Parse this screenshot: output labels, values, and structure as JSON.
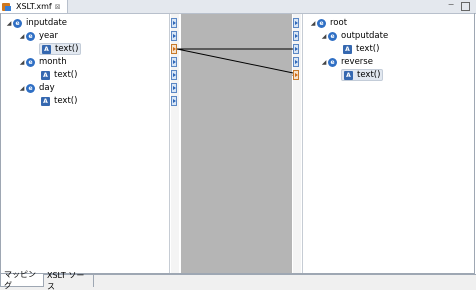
{
  "editor_tab": {
    "title": "XSLT.xmf",
    "close": "⊠"
  },
  "window_controls": {
    "minimize": "−"
  },
  "source_tree": {
    "root": "inputdate",
    "nodes": [
      {
        "name": "year",
        "child": "text()"
      },
      {
        "name": "month",
        "child": "text()"
      },
      {
        "name": "day",
        "child": "text()"
      }
    ]
  },
  "target_tree": {
    "root": "root",
    "nodes": [
      {
        "name": "outputdate",
        "child": "text()"
      },
      {
        "name": "reverse",
        "child": "text()"
      }
    ]
  },
  "icons": {
    "element": "e",
    "attribute": "A",
    "expanded": "◢"
  },
  "bottom_tabs": [
    "マッピング",
    "XSLT ソース"
  ],
  "colors": {
    "mapping_area": "#b5b5b5",
    "node_icon": "#2f6fc4",
    "connector_orange": "#d06a12"
  }
}
